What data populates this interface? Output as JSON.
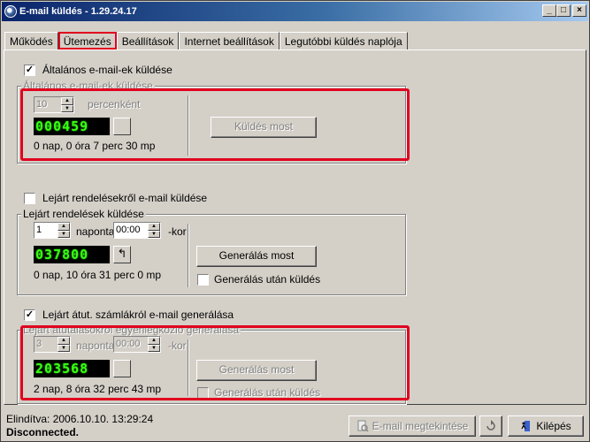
{
  "window": {
    "title": "E-mail küldés  -  1.29.24.17"
  },
  "tabs": [
    {
      "label": "Működés"
    },
    {
      "label": "Ütemezés"
    },
    {
      "label": "Beállítások"
    },
    {
      "label": "Internet beállítások"
    },
    {
      "label": "Legutóbbi küldés naplója"
    }
  ],
  "section1": {
    "checkbox_label": "Általános e-mail-ek küldése",
    "checked": true,
    "group_title": "Általános e-mail-ek küldése",
    "interval_value": "10",
    "interval_unit": "percenként",
    "led": [
      "0",
      "0",
      "0",
      "4",
      "5",
      "9"
    ],
    "countdown": "0 nap, 0 óra 7 perc 30 mp",
    "send_button": "Küldés most"
  },
  "section2": {
    "checkbox_label": "Lejárt rendelésekről e-mail küldése",
    "checked": false,
    "group_title": "Lejárt rendelések küldése",
    "days_value": "1",
    "days_unit": "naponta",
    "time_value": "00:00",
    "time_suffix": "-kor",
    "led": [
      "0",
      "3",
      "7",
      "8",
      "0",
      "0"
    ],
    "countdown": "0 nap, 10 óra 31 perc 0 mp",
    "generate_button": "Generálás most",
    "after_label": "Generálás után küldés"
  },
  "section3": {
    "checkbox_label": "Lejárt átut. számlákról e-mail generálása",
    "checked": true,
    "group_title": "Lejárt átutalásokról egyenlegközlő generálása",
    "days_value": "3",
    "days_unit": "naponta",
    "time_value": "00:00",
    "time_suffix": "-kor",
    "led": [
      "2",
      "0",
      "3",
      "5",
      "6",
      "8"
    ],
    "countdown": "2 nap, 8 óra 32 perc 43 mp",
    "generate_button": "Generálás most",
    "after_label": "Generálás után küldés"
  },
  "status": {
    "started": "Elindítva: 2006.10.10. 13:29:24",
    "connection": "Disconnected.",
    "preview_button": "E-mail megtekintése",
    "exit_button": "Kilépés"
  },
  "colors": {
    "highlight": "#e0001e",
    "led": "#39ff14"
  }
}
